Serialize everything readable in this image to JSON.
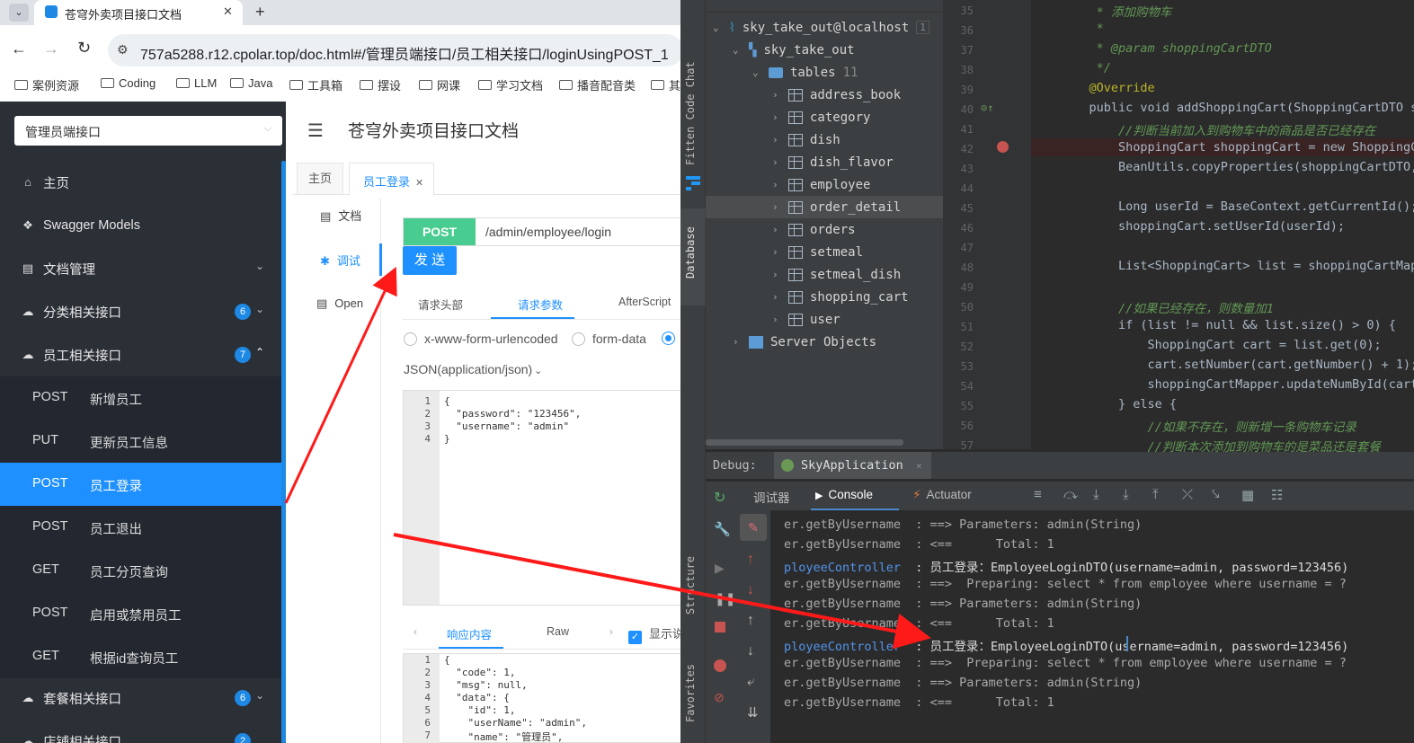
{
  "browser": {
    "tab_title": "苍穹外卖项目接口文档",
    "new_tab": "+",
    "address": "757a5288.r12.cpolar.top/doc.html#/管理员端接口/员工相关接口/loginUsingPOST_1",
    "bookmarks": [
      "案例资源",
      "Coding",
      "LLM",
      "Java",
      "工具箱",
      "摆设",
      "网课",
      "学习文档",
      "播音配音类",
      "其"
    ]
  },
  "doc": {
    "group_select": "管理员端接口",
    "page_title": "苍穹外卖项目接口文档",
    "menu": {
      "home": "主页",
      "models": "Swagger Models",
      "docmgmt": "文档管理",
      "category": "分类相关接口",
      "category_badge": "6",
      "employee": "员工相关接口",
      "employee_badge": "7",
      "setmeal": "套餐相关接口",
      "setmeal_badge": "6",
      "shop": "店铺相关接口",
      "shop_badge": "2"
    },
    "employee_apis": [
      {
        "method": "POST",
        "name": "新增员工"
      },
      {
        "method": "PUT",
        "name": "更新员工信息"
      },
      {
        "method": "POST",
        "name": "员工登录"
      },
      {
        "method": "POST",
        "name": "员工退出"
      },
      {
        "method": "GET",
        "name": "员工分页查询"
      },
      {
        "method": "POST",
        "name": "启用或禁用员工"
      },
      {
        "method": "GET",
        "name": "根据id查询员工"
      }
    ],
    "tabs": {
      "home": "主页",
      "login": "员工登录"
    },
    "side_tabs": {
      "doc": "文档",
      "debug": "调试",
      "open": "Open"
    },
    "method": "POST",
    "url": "/admin/employee/login",
    "send": "发 送",
    "req_tabs": {
      "headers": "请求头部",
      "params": "请求参数",
      "after": "AfterScript"
    },
    "radios": {
      "urlencoded": "x-www-form-urlencoded",
      "formdata": "form-data"
    },
    "content_type": "JSON(application/json)",
    "request_lines": [
      "{",
      "  \"password\": \"123456\",",
      "  \"username\": \"admin\"",
      "}"
    ],
    "resp_tabs": {
      "content": "响应内容",
      "raw": "Raw",
      "show": "显示说"
    },
    "response_lines": [
      "{",
      "  \"code\": 1,",
      "  \"msg\": null,",
      "  \"data\": {",
      "    \"id\": 1,",
      "    \"userName\": \"admin\",",
      "    \"name\": \"管理员\","
    ]
  },
  "ide": {
    "strip": {
      "fitten": "Fitten Code Chat",
      "database": "Database",
      "structure": "Structure",
      "favorites": "Favorites"
    },
    "db": {
      "root": "sky_take_out@localhost",
      "root_badge": "1",
      "schema": "sky_take_out",
      "tables_label": "tables",
      "tables_count": "11",
      "tables": [
        "address_book",
        "category",
        "dish",
        "dish_flavor",
        "employee",
        "order_detail",
        "orders",
        "setmeal",
        "setmeal_dish",
        "shopping_cart",
        "user"
      ],
      "server_objects": "Server Objects"
    },
    "line_numbers": [
      "35",
      "36",
      "37",
      "38",
      "39",
      "40",
      "41",
      "42",
      "43",
      "44",
      "45",
      "46",
      "47",
      "48",
      "49",
      "50",
      "51",
      "52",
      "53",
      "54",
      "55",
      "56",
      "57"
    ],
    "code": [
      "     * 添加购物车",
      "     *",
      "     * @param shoppingCartDTO",
      "     */",
      "    @Override",
      "    public void addShoppingCart(ShoppingCartDTO shopp",
      "        //判断当前加入到购物车中的商品是否已经存在",
      "        ShoppingCart shoppingCart = new ShoppingCart(",
      "        BeanUtils.copyProperties(shoppingCartDTO, sho",
      "",
      "        Long userId = BaseContext.getCurrentId();",
      "        shoppingCart.setUserId(userId);",
      "",
      "        List<ShoppingCart> list = shoppingCartMapper.",
      "",
      "        //如果已经存在，则数量加1",
      "        if (list != null && list.size() > 0) {",
      "            ShoppingCart cart = list.get(0);",
      "            cart.setNumber(cart.getNumber() + 1);",
      "            shoppingCartMapper.updateNumById(cart);",
      "        } else {",
      "            //如果不存在，则新增一条购物车记录",
      "            //判断本次添加到购物车的是菜品还是套餐"
    ],
    "debug_label": "Debug:",
    "run_config": "SkyApplication",
    "debug_tabs": {
      "debugger": "调试器",
      "console": "Console",
      "actuator": "Actuator"
    },
    "console_lines": [
      {
        "cls": "er.getByUsername",
        "msg": "  : ==> Parameters: admin(String)"
      },
      {
        "cls": "er.getByUsername",
        "msg": "  : <==      Total: 1"
      },
      {
        "cls": "ployeeController",
        "msg": "  : 员工登录：EmployeeLoginDTO(username=admin, password=123456)"
      },
      {
        "cls": "er.getByUsername",
        "msg": "  : ==>  Preparing: select * from employee where username = ?"
      },
      {
        "cls": "er.getByUsername",
        "msg": "  : ==> Parameters: admin(String)"
      },
      {
        "cls": "er.getByUsername",
        "msg": "  : <==      Total: 1"
      },
      {
        "cls": "ployeeController",
        "msg": "  : 员工登录：EmployeeLoginDTO(username=admin, password=123456)"
      },
      {
        "cls": "er.getByUsername",
        "msg": "  : ==>  Preparing: select * from employee where username = ?"
      },
      {
        "cls": "er.getByUsername",
        "msg": "  : ==> Parameters: admin(String)"
      },
      {
        "cls": "er.getByUsername",
        "msg": "  : <==      Total: 1"
      }
    ]
  },
  "colors": {
    "accent_blue": "#1e90ff",
    "post_green": "#49cc90",
    "annotation_red": "#ff1a1a",
    "breakpoint_line": "#3a2323"
  }
}
